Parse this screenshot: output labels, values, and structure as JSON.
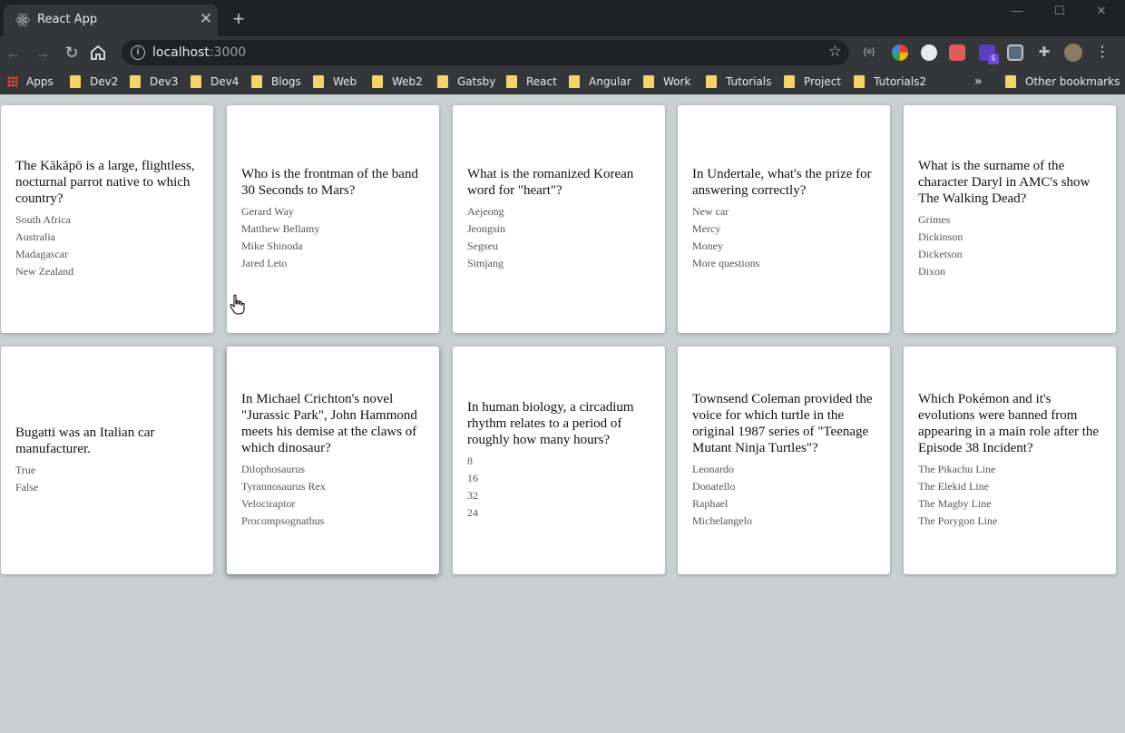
{
  "browser": {
    "tab_title": "React App",
    "url_host": "localhost",
    "url_port": ":3000",
    "bookmarks": [
      "Apps",
      "Dev2",
      "Dev3",
      "Dev4",
      "Blogs",
      "Web",
      "Web2",
      "Gatsby",
      "React",
      "Angular",
      "Work",
      "Tutorials",
      "Project",
      "Tutorials2"
    ],
    "other_bookmarks": "Other bookmarks",
    "extension_badge": "5"
  },
  "cards": [
    {
      "question": "The Kākāpō is a large, flightless, nocturnal parrot native to which country?",
      "answers": [
        "South Africa",
        "Australia",
        "Madagascar",
        "New Zealand"
      ]
    },
    {
      "question": "Who is the frontman of the band 30 Seconds to Mars?",
      "answers": [
        "Gerard Way",
        "Matthew Bellamy",
        "Mike Shinoda",
        "Jared Leto"
      ]
    },
    {
      "question": "What is the romanized Korean word for \"heart\"?",
      "answers": [
        "Aejeong",
        "Jeongsin",
        "Segseu",
        "Simjang"
      ]
    },
    {
      "question": "In Undertale, what's the prize for answering correctly?",
      "answers": [
        "New car",
        "Mercy",
        "Money",
        "More questions"
      ]
    },
    {
      "question": "What is the surname of the character Daryl in AMC's show The Walking Dead?",
      "answers": [
        "Grimes",
        "Dickinson",
        "Dicketson",
        "Dixon"
      ]
    },
    {
      "question": "Bugatti was an Italian car manufacturer.",
      "answers": [
        "True",
        "False"
      ]
    },
    {
      "question": "In Michael Crichton's novel \"Jurassic Park\", John Hammond meets his demise at the claws of which dinosaur?",
      "answers": [
        "Dilophosaurus",
        "Tyrannosaurus Rex",
        "Velociraptor",
        "Procompsognathus"
      ]
    },
    {
      "question": "In human biology, a circadium rhythm relates to a period of roughly how many hours?",
      "answers": [
        "8",
        "16",
        "32",
        "24"
      ]
    },
    {
      "question": "Townsend Coleman provided the voice for which turtle in the original 1987 series of \"Teenage Mutant Ninja Turtles\"?",
      "answers": [
        "Leonardo",
        "Donatello",
        "Raphael",
        "Michelangelo"
      ]
    },
    {
      "question": "Which Pokémon and it's evolutions were banned from appearing in a main role after the Episode 38 Incident?",
      "answers": [
        "The Pikachu Line",
        "The Elekid Line",
        "The Magby Line",
        "The Porygon Line"
      ]
    }
  ]
}
